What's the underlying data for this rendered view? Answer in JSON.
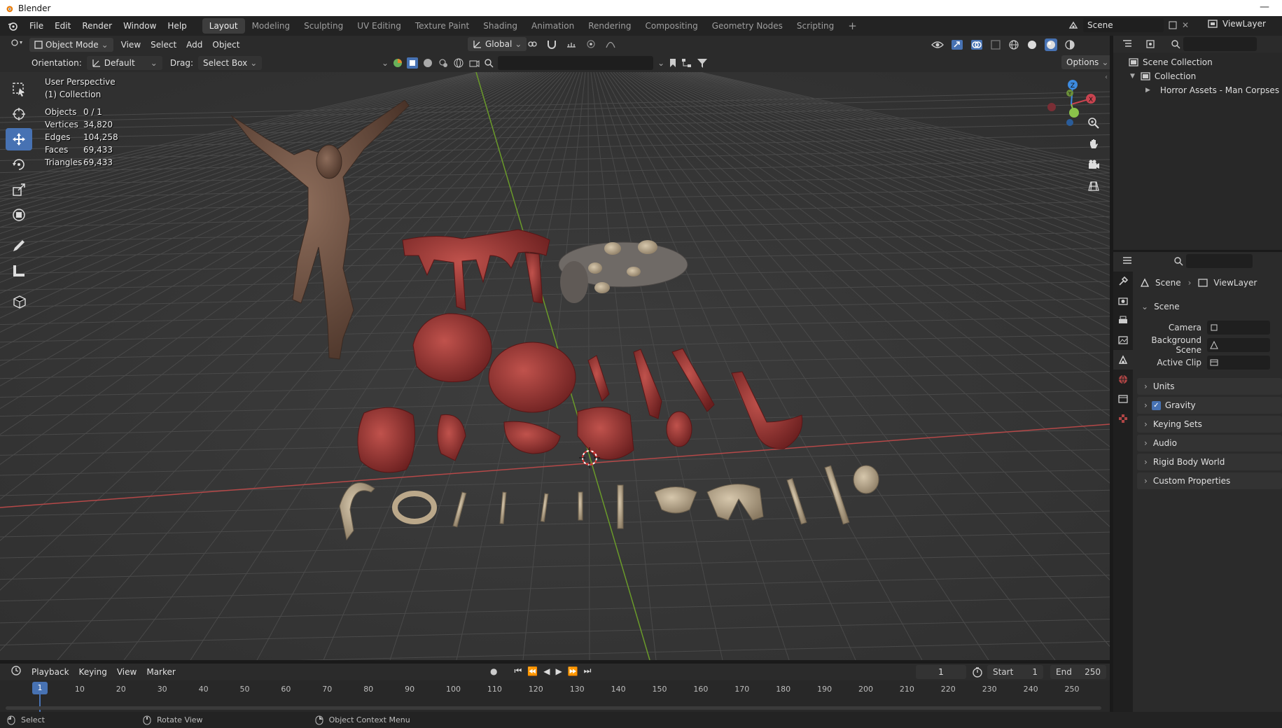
{
  "window": {
    "title": "Blender"
  },
  "menus": [
    "File",
    "Edit",
    "Render",
    "Window",
    "Help"
  ],
  "workspaces": [
    "Layout",
    "Modeling",
    "Sculpting",
    "UV Editing",
    "Texture Paint",
    "Shading",
    "Animation",
    "Rendering",
    "Compositing",
    "Geometry Nodes",
    "Scripting"
  ],
  "active_workspace": "Layout",
  "top_right": {
    "scene": "Scene",
    "view_layer": "ViewLayer"
  },
  "viewport_header": {
    "mode": "Object Mode",
    "menus": [
      "View",
      "Select",
      "Add",
      "Object"
    ],
    "transform_orientation": "Global",
    "orientation_label": "Orientation:",
    "orientation_value": "Default",
    "drag_label": "Drag:",
    "drag_value": "Select Box",
    "options_label": "Options"
  },
  "viewport_overlay": {
    "perspective": "User Perspective",
    "collection": "(1) Collection",
    "stats": [
      {
        "k": "Objects",
        "v": "0 / 1"
      },
      {
        "k": "Vertices",
        "v": "34,820"
      },
      {
        "k": "Edges",
        "v": "104,258"
      },
      {
        "k": "Faces",
        "v": "69,433"
      },
      {
        "k": "Triangles",
        "v": "69,433"
      }
    ]
  },
  "gizmo": {
    "x": "X",
    "y": "Y",
    "z": "Z"
  },
  "timeline": {
    "menus": [
      "Playback",
      "Keying",
      "View",
      "Marker"
    ],
    "current_frame": "1",
    "start_label": "Start",
    "start": "1",
    "end_label": "End",
    "end": "250",
    "ticks": [
      "10",
      "20",
      "30",
      "40",
      "50",
      "60",
      "70",
      "80",
      "90",
      "100",
      "110",
      "120",
      "130",
      "140",
      "150",
      "160",
      "170",
      "180",
      "190",
      "200",
      "210",
      "220",
      "230",
      "240",
      "250"
    ],
    "playhead": "1"
  },
  "statusbar": {
    "select": "Select",
    "rotate": "Rotate View",
    "context": "Object Context Menu"
  },
  "outliner": {
    "scene_collection": "Scene Collection",
    "collection": "Collection",
    "object": "Horror Assets - Man Corpses Pac"
  },
  "properties": {
    "breadcrumb_scene": "Scene",
    "breadcrumb_viewlayer": "ViewLayer",
    "section": "Scene",
    "camera_label": "Camera",
    "background_label": "Background Scene",
    "clip_label": "Active Clip",
    "panels": [
      "Units",
      "Gravity",
      "Keying Sets",
      "Audio",
      "Rigid Body World",
      "Custom Properties"
    ],
    "gravity_checked": true
  },
  "colors": {
    "accent": "#4772b3",
    "x_axis": "#c8434f",
    "y_axis": "#8bc34a",
    "z_axis": "#3d8be0"
  }
}
